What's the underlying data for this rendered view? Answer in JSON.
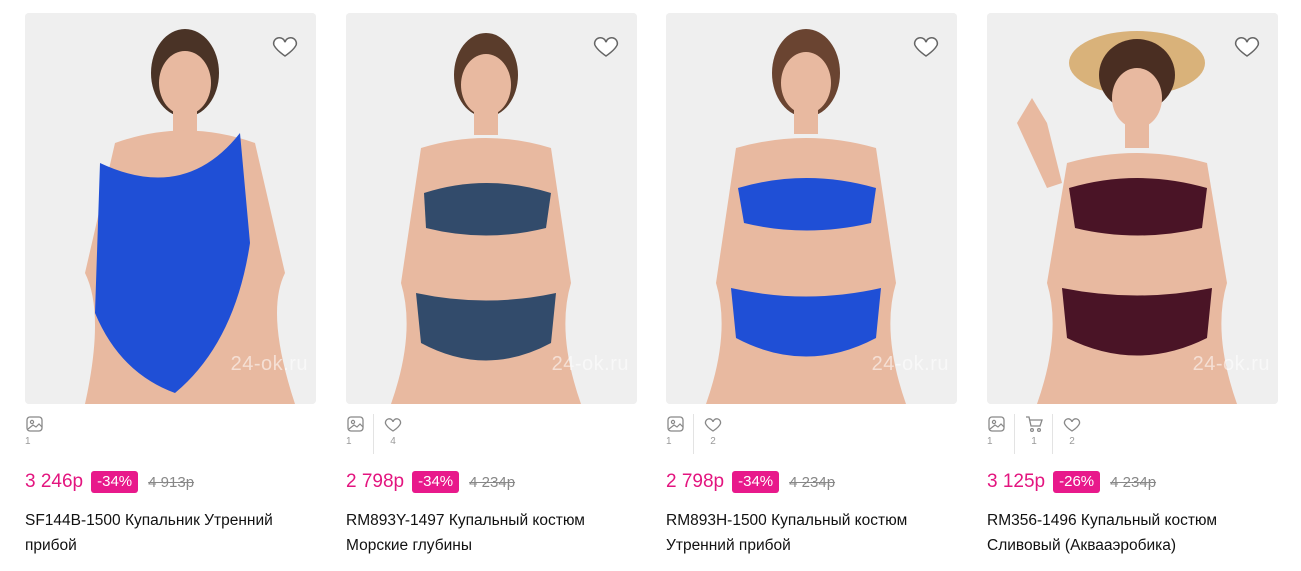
{
  "products": [
    {
      "image_count": "1",
      "price": "3 246р",
      "discount": "-34%",
      "old_price": "4 913р",
      "title": "SF144B-1500 Купальник Утренний прибой",
      "swim_color": "#1f4fd6",
      "watermark": "24-ok.ru"
    },
    {
      "image_count": "1",
      "likes_count": "4",
      "price": "2 798р",
      "discount": "-34%",
      "old_price": "4 234р",
      "title": "RM893Y-1497 Купальный костюм Морские глубины",
      "swim_color": "#324b6b",
      "watermark": "24-ok.ru"
    },
    {
      "image_count": "1",
      "likes_count": "2",
      "price": "2 798р",
      "discount": "-34%",
      "old_price": "4 234р",
      "title": "RM893H-1500 Купальный костюм Утренний прибой",
      "swim_color": "#1f4fd6",
      "watermark": "24-ok.ru"
    },
    {
      "image_count": "1",
      "cart_count": "1",
      "likes_count": "2",
      "price": "3 125р",
      "discount": "-26%",
      "old_price": "4 234р",
      "title": "RM356-1496 Купальный костюм Сливовый (Аквааэробика)",
      "swim_color": "#4a1426",
      "watermark": "24-ok.ru"
    }
  ],
  "colors": {
    "price": "#e3157f",
    "discount_badge": "#e8198b",
    "photo_bg": "#efefef",
    "skin": "#e8b9a0"
  }
}
